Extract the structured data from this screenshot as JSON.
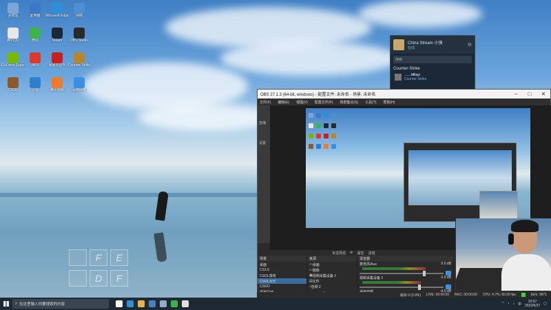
{
  "desktop": {
    "icons": [
      {
        "label": "回收站",
        "color": "#7aa7d8"
      },
      {
        "label": "此电脑",
        "color": "#3a79c7"
      },
      {
        "label": "Microsoft Edge",
        "color": "#2e8fd6"
      },
      {
        "label": "网络",
        "color": "#4d8fd1"
      },
      {
        "label": "腾讯QQ",
        "color": "#e8e8e8"
      },
      {
        "label": "微信",
        "color": "#3db34a"
      },
      {
        "label": "Steam",
        "color": "#1b2838"
      },
      {
        "label": "OBS Studio",
        "color": "#2a2a2a"
      },
      {
        "label": "GeForce Experience",
        "color": "#76b900"
      },
      {
        "label": "WPS",
        "color": "#d93a2b"
      },
      {
        "label": "网易云音乐",
        "color": "#c7201f"
      },
      {
        "label": "Counter-Strike",
        "color": "#b8862e"
      },
      {
        "label": "CSOL",
        "color": "#8b5a2b"
      },
      {
        "label": "迅雷",
        "color": "#2f7fd1"
      },
      {
        "label": "腾讯视频",
        "color": "#ee7a2a"
      },
      {
        "label": "百度网盘",
        "color": "#3b8ee6"
      }
    ],
    "tiles": [
      "",
      "F",
      "E",
      "",
      "",
      "D",
      "F"
    ]
  },
  "steam_popup": {
    "name": "China Stream 小强",
    "status": "在线",
    "search_placeholder": "搜索",
    "section_title": "Counter-Strike",
    "friend_name": "……Mllayi",
    "friend_status": "Counter-Strike"
  },
  "obs": {
    "title": "OBS 27.1.3 (64-bit, windows) - 配置文件: 未命名 - 场景: 未命名",
    "menu": [
      "文件(F)",
      "编辑(E)",
      "视图(V)",
      "配置文件(P)",
      "场景集合(S)",
      "工具(T)",
      "帮助(H)"
    ],
    "side_labels": [
      "直播",
      "设置"
    ],
    "toolbar_label": "未选择源",
    "toolbar_items": [
      "属性",
      "滤镜"
    ],
    "docks": {
      "scenes": {
        "title": "场景",
        "items": [
          "桌面",
          "CS1.6",
          "CSOL游戏",
          "CSOL大厅",
          "CSGO",
          "屏幕区域",
          "屏幕区域游戏"
        ]
      },
      "sources": {
        "title": "来源",
        "items": [
          "桌面",
          "摄像",
          "视频采集设备 2",
          "文件",
          "音频 2"
        ]
      },
      "mixer": {
        "title": "混音器",
        "channels": [
          {
            "name": "麦克风/Aux",
            "db": "0.0 dB",
            "level": 0.75
          },
          {
            "name": "视频采集设备 2",
            "db": "0.0 dB",
            "level": 0.7
          },
          {
            "name": "桌面音频",
            "db": "-4.5 dB",
            "level": 0.6
          }
        ]
      }
    },
    "status": {
      "drop": "丢帧 0 (0.0%)",
      "live": "LIVE: 00:00:00",
      "rec": "REC: 00:00:00",
      "cpu": "CPU: 4.7%, 60.00 fps",
      "kbps": "kb/s: 3871"
    }
  },
  "taskbar": {
    "search_placeholder": "在这里输入你要搜索的内容",
    "pinned": [
      {
        "name": "task-view",
        "color": "#ffffff"
      },
      {
        "name": "edge",
        "color": "#2e8fd6"
      },
      {
        "name": "explorer",
        "color": "#e6b34c"
      },
      {
        "name": "store",
        "color": "#4b7fc4"
      },
      {
        "name": "steam",
        "color": "#8fb0c8"
      },
      {
        "name": "wechat",
        "color": "#3db34a"
      },
      {
        "name": "obs",
        "color": "#e0e0e0"
      }
    ],
    "time": "20:57",
    "date": "2022/6/27",
    "lang": "中"
  }
}
